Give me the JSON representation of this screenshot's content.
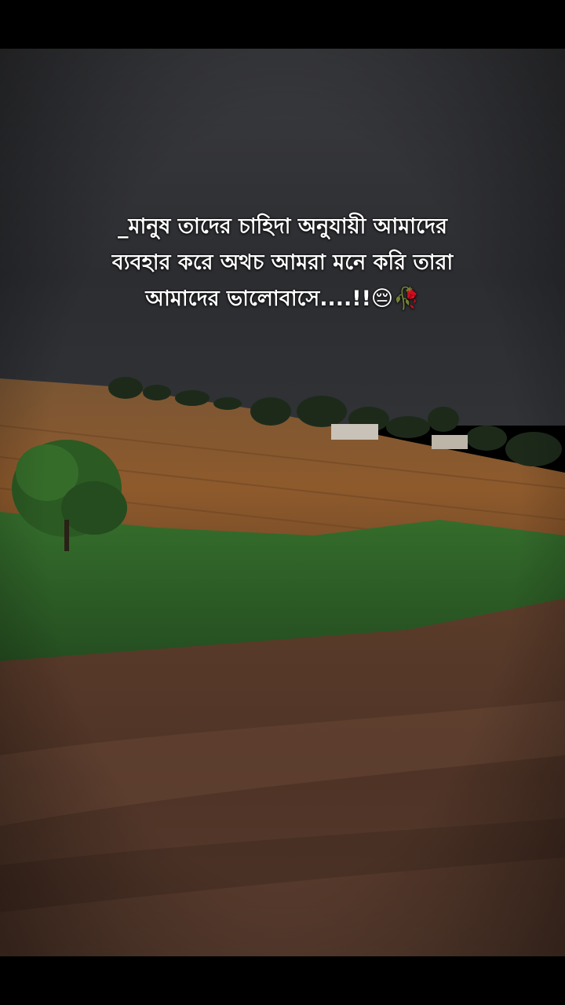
{
  "caption": {
    "line1": "_মানুষ তাদের চাহিদা অনুযায়ী আমাদের",
    "line2": "ব্যবহার করে অথচ আমরা মনে করি তারা",
    "line3": "আমাদের ভালোবাসে....!!😔🥀"
  },
  "colors": {
    "sky": "#2e2f33",
    "field": "#8a5a2e",
    "grass": "#2f6b2a",
    "mud": "#5a3b2a",
    "letterbox": "#000000"
  }
}
